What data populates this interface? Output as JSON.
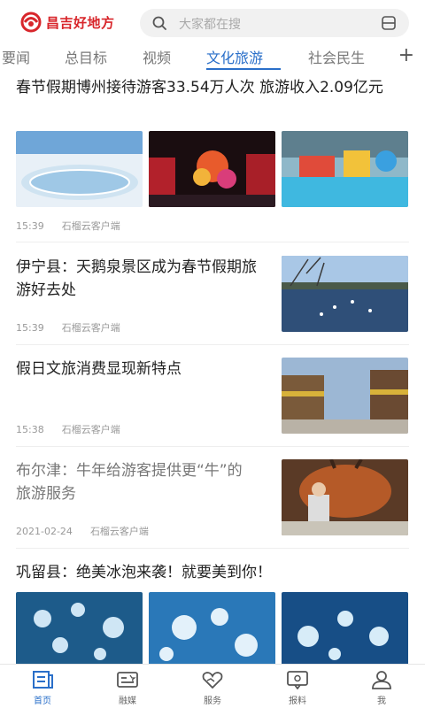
{
  "header": {
    "logo_text": "昌吉好地方",
    "search_placeholder": "大家都在搜"
  },
  "tabs": [
    {
      "label": "要闻"
    },
    {
      "label": "总目标"
    },
    {
      "label": "视频"
    },
    {
      "label": "文化旅游"
    },
    {
      "label": "社会民生"
    }
  ],
  "active_tab": "文化旅游",
  "news": [
    {
      "title": "春节假期博州接待游客33.54万人次 旅游收入2.09亿元",
      "time": "15:39",
      "source": "石榴云客户端"
    },
    {
      "title": "伊宁县：天鹅泉景区成为春节假期旅游好去处",
      "time": "15:39",
      "source": "石榴云客户端"
    },
    {
      "title": "假日文旅消费显现新特点",
      "time": "15:38",
      "source": "石榴云客户端"
    },
    {
      "title": "布尔津：牛年给游客提供更“牛”的旅游服务",
      "time": "2021-02-24",
      "source": "石榴云客户端"
    },
    {
      "title": "巩留县：绝美冰泡来袭！就要美到你！"
    }
  ],
  "bottom_nav": [
    {
      "label": "首页",
      "icon": "news-home-icon",
      "active": true
    },
    {
      "label": "融媒",
      "icon": "media-icon"
    },
    {
      "label": "服务",
      "icon": "heart-service-icon"
    },
    {
      "label": "报料",
      "icon": "report-icon"
    },
    {
      "label": "我",
      "icon": "user-icon"
    }
  ],
  "colors": {
    "brand_red": "#d8262b",
    "accent_blue": "#2a6fc9"
  }
}
